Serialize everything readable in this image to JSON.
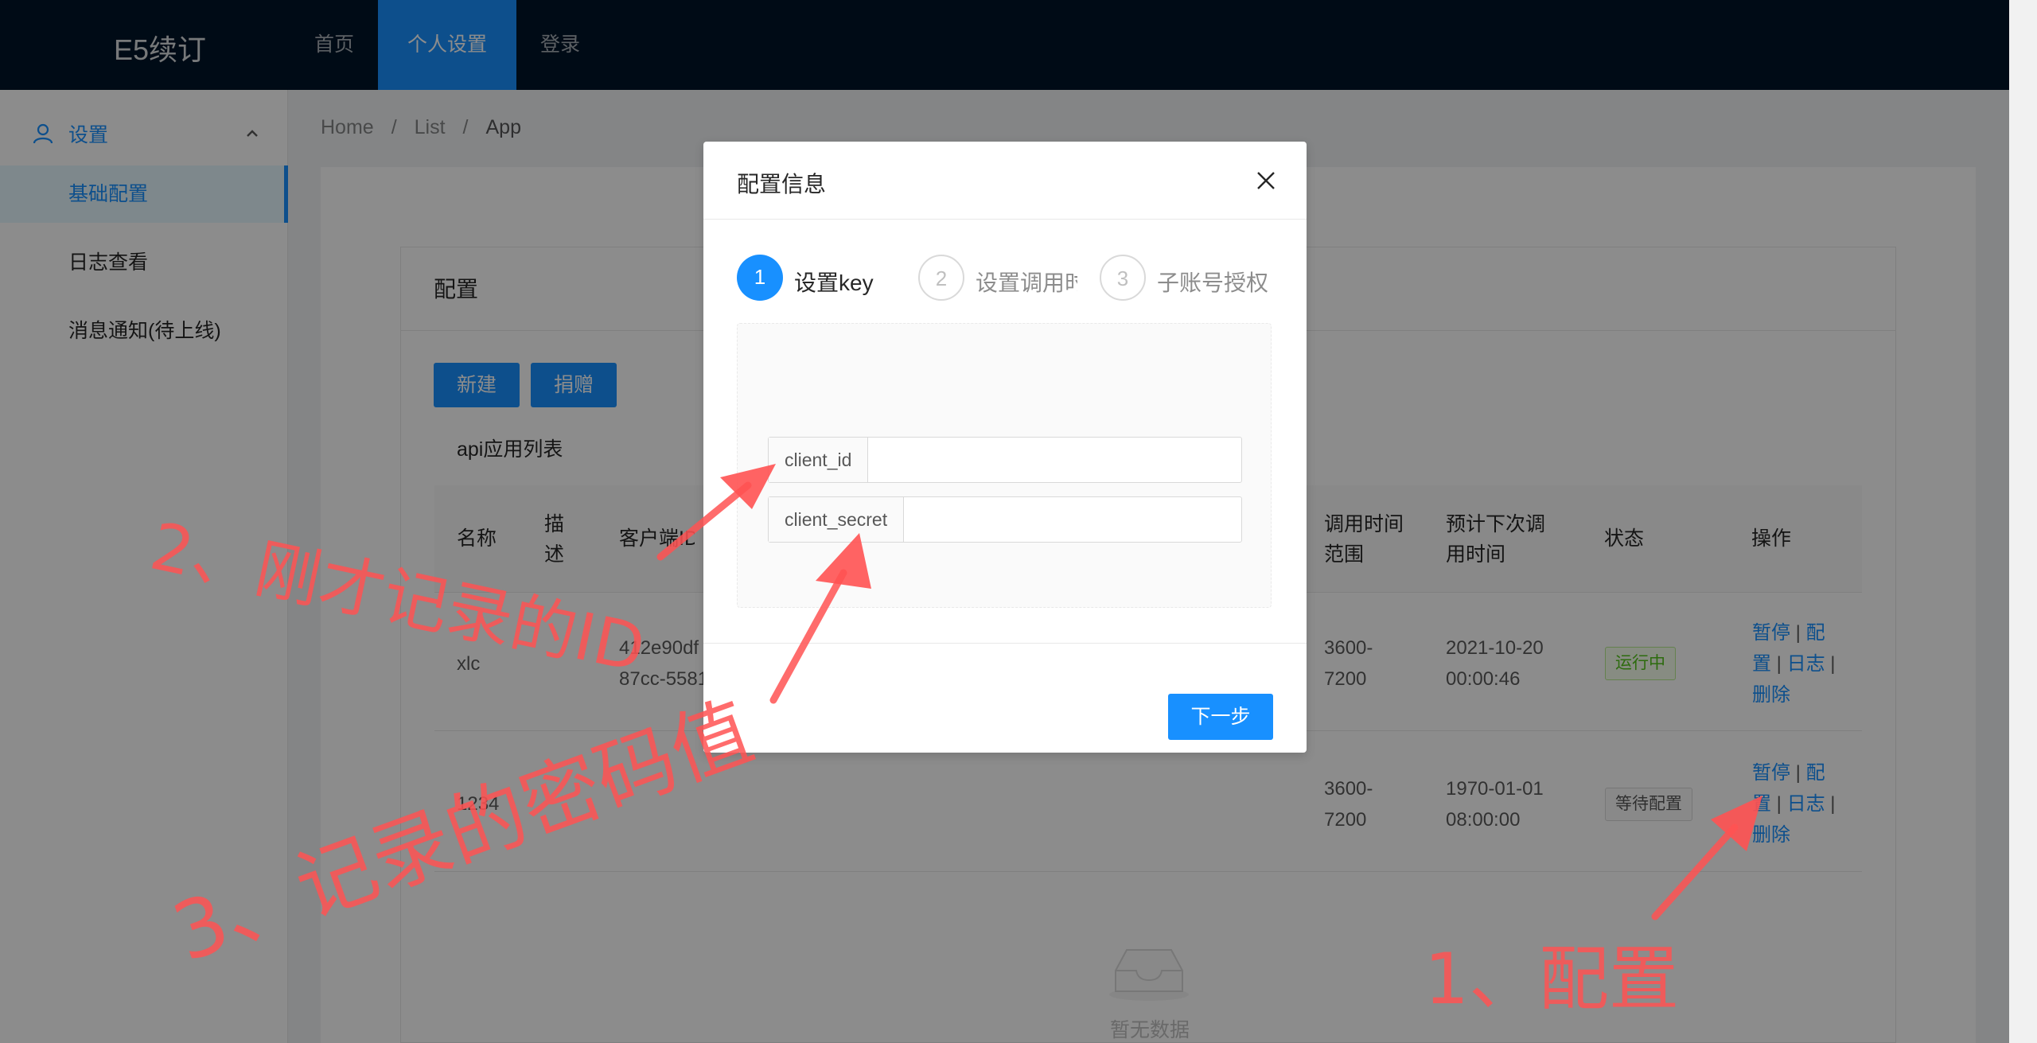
{
  "header": {
    "logo": "E5续订",
    "nav": [
      "首页",
      "个人设置",
      "登录"
    ]
  },
  "sidebar": {
    "submenu_title": "设置",
    "items": [
      "基础配置",
      "日志查看",
      "消息通知(待上线)"
    ]
  },
  "breadcrumb": [
    "Home",
    "/",
    "List",
    "/",
    "App"
  ],
  "card": {
    "title": "配置",
    "buttons": {
      "new": "新建",
      "donate": "捐赠"
    },
    "list_title": "api应用列表",
    "columns": [
      "名称",
      "描述",
      "客户端ID",
      "调用时间范围",
      "预计下次调用时间",
      "状态",
      "操作"
    ],
    "rows": [
      {
        "name": "xlc",
        "client_id_1": "412e90df",
        "client_id_2": "87cc-5581",
        "range_1": "3600-",
        "range_2": "7200",
        "next_1": "2021-10-20",
        "next_2": "00:00:46",
        "status": "运行中"
      },
      {
        "name": "1234",
        "range_1": "3600-",
        "range_2": "7200",
        "next_1": "1970-01-01",
        "next_2": "08:00:00",
        "status": "等待配置"
      }
    ],
    "ops": {
      "pause": "暂停",
      "sep": "|",
      "config_1": "配",
      "config_2": "置",
      "log": "日志",
      "delete": "删除"
    },
    "empty_text": "暂无数据"
  },
  "modal": {
    "title": "配置信息",
    "steps": [
      {
        "num": "1",
        "label": "设置key"
      },
      {
        "num": "2",
        "label": "设置调用时"
      },
      {
        "num": "3",
        "label": "子账号授权"
      }
    ],
    "fields": [
      {
        "label": "client_id",
        "value": ""
      },
      {
        "label": "client_secret",
        "value": ""
      }
    ],
    "next_button": "下一步"
  },
  "annotations": {
    "note_2": "2、刚才记录的ID",
    "note_3": "3、记录的密码值",
    "note_1": "1、配置"
  },
  "colors": {
    "primary": "#1890ff",
    "header_bg": "#001529",
    "annotation": "#ff5252"
  }
}
